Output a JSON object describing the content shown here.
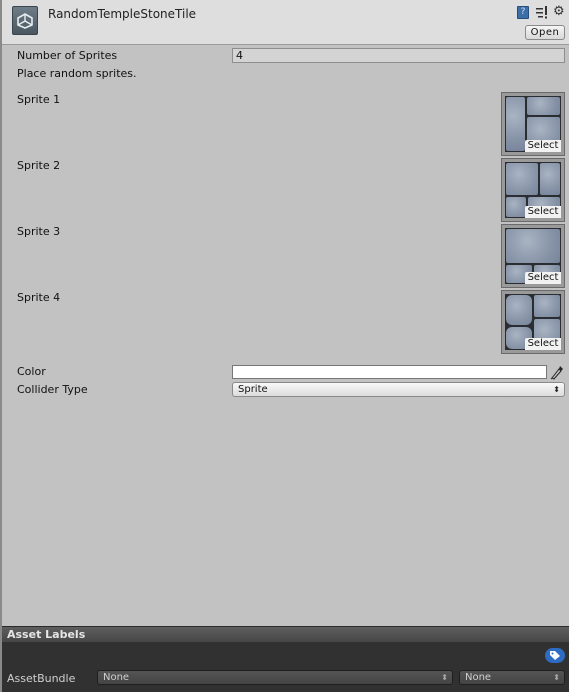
{
  "header": {
    "title": "RandomTempleStoneTile",
    "icons": [
      "unity-logo-icon",
      "help-icon",
      "presets-icon",
      "gear-icon"
    ],
    "help_glyph": "?",
    "open_label": "Open"
  },
  "fields": {
    "number_of_sprites_label": "Number of Sprites",
    "number_of_sprites_value": "4",
    "help_text": "Place random sprites.",
    "sprites": [
      {
        "label": "Sprite 1",
        "select_label": "Select"
      },
      {
        "label": "Sprite 2",
        "select_label": "Select"
      },
      {
        "label": "Sprite 3",
        "select_label": "Select"
      },
      {
        "label": "Sprite 4",
        "select_label": "Select"
      }
    ],
    "color_label": "Color",
    "color_value": "#ffffff",
    "collider_type_label": "Collider Type",
    "collider_type_value": "Sprite"
  },
  "asset_labels": {
    "title": "Asset Labels",
    "assetbundle_label": "AssetBundle",
    "assetbundle_name": "None",
    "assetbundle_variant": "None"
  },
  "colors": {
    "panel_bg": "#c2c2c2",
    "header_bg": "#dedede",
    "tag_button": "#2e6cc4",
    "dark_section": "#313131"
  }
}
